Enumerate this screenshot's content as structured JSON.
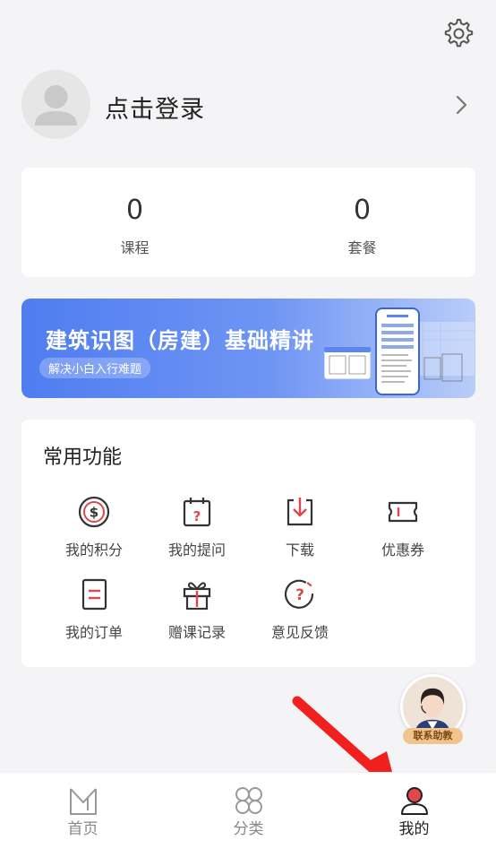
{
  "profile": {
    "login_text": "点击登录"
  },
  "stats": [
    {
      "value": "0",
      "label": "课程"
    },
    {
      "value": "0",
      "label": "套餐"
    }
  ],
  "banner": {
    "title": "建筑识图（房建）基础精讲",
    "subtitle": "解决小白入行难题"
  },
  "functions": {
    "title": "常用功能",
    "items": [
      {
        "label": "我的积分",
        "icon": "points-icon"
      },
      {
        "label": "我的提问",
        "icon": "question-calendar-icon"
      },
      {
        "label": "下载",
        "icon": "download-icon"
      },
      {
        "label": "优惠券",
        "icon": "coupon-icon"
      },
      {
        "label": "我的订单",
        "icon": "order-icon"
      },
      {
        "label": "赠课记录",
        "icon": "gift-icon"
      },
      {
        "label": "意见反馈",
        "icon": "feedback-icon"
      }
    ]
  },
  "assistant": {
    "badge": "联系助教"
  },
  "tabbar": {
    "items": [
      {
        "label": "首页",
        "icon": "home-icon"
      },
      {
        "label": "分类",
        "icon": "category-icon"
      },
      {
        "label": "我的",
        "icon": "profile-icon",
        "active": true
      }
    ]
  },
  "colors": {
    "accent": "#e0474c",
    "banner": "#5b86f2"
  }
}
